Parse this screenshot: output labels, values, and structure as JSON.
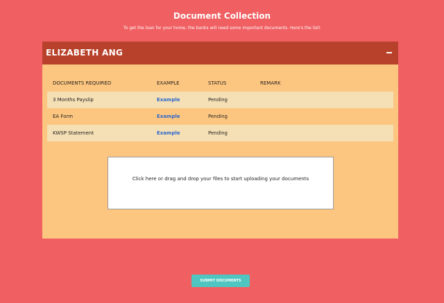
{
  "page": {
    "title": "Document Collection",
    "subtitle": "To get the loan for your home, the banks will need some important documents. Here's the list!"
  },
  "applicant": {
    "name": "ELIZABETH ANG",
    "collapse_icon": "minus-icon"
  },
  "table": {
    "headers": [
      "DOCUMENTS REQUIRED",
      "EXAMPLE",
      "STATUS",
      "REMARK"
    ],
    "rows": [
      {
        "document": "3 Months Payslip",
        "example": "Example",
        "status": "Pending",
        "remark": ""
      },
      {
        "document": "EA Form",
        "example": "Example",
        "status": "Pending",
        "remark": ""
      },
      {
        "document": "KWSP Statement",
        "example": "Example",
        "status": "Pending",
        "remark": ""
      }
    ]
  },
  "upload": {
    "instruction": "Click here or drag and drop your files to start uploading your documents"
  },
  "actions": {
    "submit_label": "SUBMIT DOCUMENTS"
  },
  "colors": {
    "background": "#f05f62",
    "header_bar": "#b8412b",
    "panel": "#fdc680",
    "row_shade": "#f5dfb4",
    "link": "#2b66cc",
    "submit": "#4ec5c0"
  }
}
